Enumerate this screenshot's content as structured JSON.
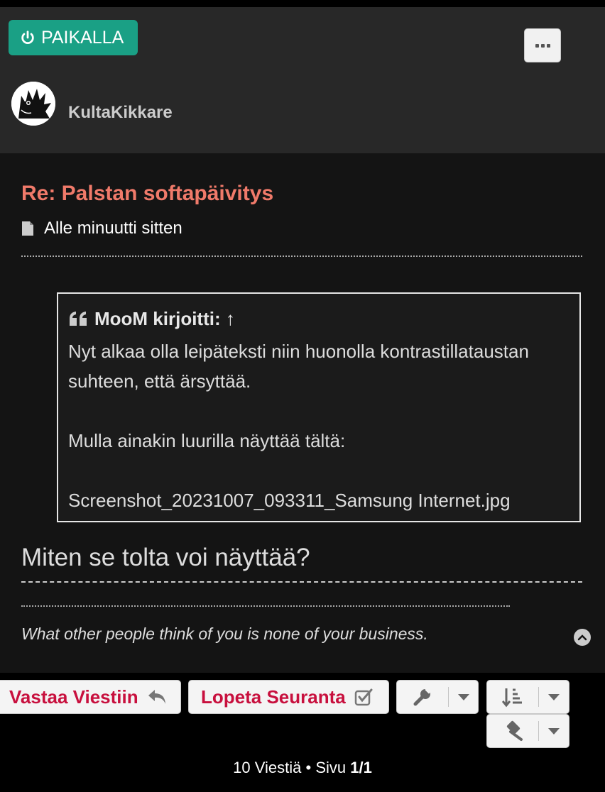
{
  "header": {
    "status_label": "PAIKALLA",
    "username": "KultaKikkare"
  },
  "post": {
    "title": "Re: Palstan softapäivitys",
    "time": "Alle minuutti sitten",
    "quote": {
      "author_line": "MooM kirjoitti: ↑",
      "paragraphs": [
        "Nyt alkaa olla leipäteksti niin huonolla kontrastillataustan suhteen, että ärsyttää.",
        "Mulla ainakin luurilla näyttää tältä:",
        "Screenshot_20231007_093311_Samsung Internet.jpg"
      ]
    },
    "reply_text": "Miten se tolta voi näyttää?",
    "signature": "What other people think of you is none of your business."
  },
  "actions": {
    "reply_label": "Vastaa Viestiin",
    "unwatch_label": "Lopeta Seuranta"
  },
  "pagination": {
    "count_text": "10 Viestiä • Sivu ",
    "page": "1/1"
  },
  "colors": {
    "status_green": "#1aa085",
    "title_red": "#f07a6a",
    "button_text": "#c8103e"
  }
}
